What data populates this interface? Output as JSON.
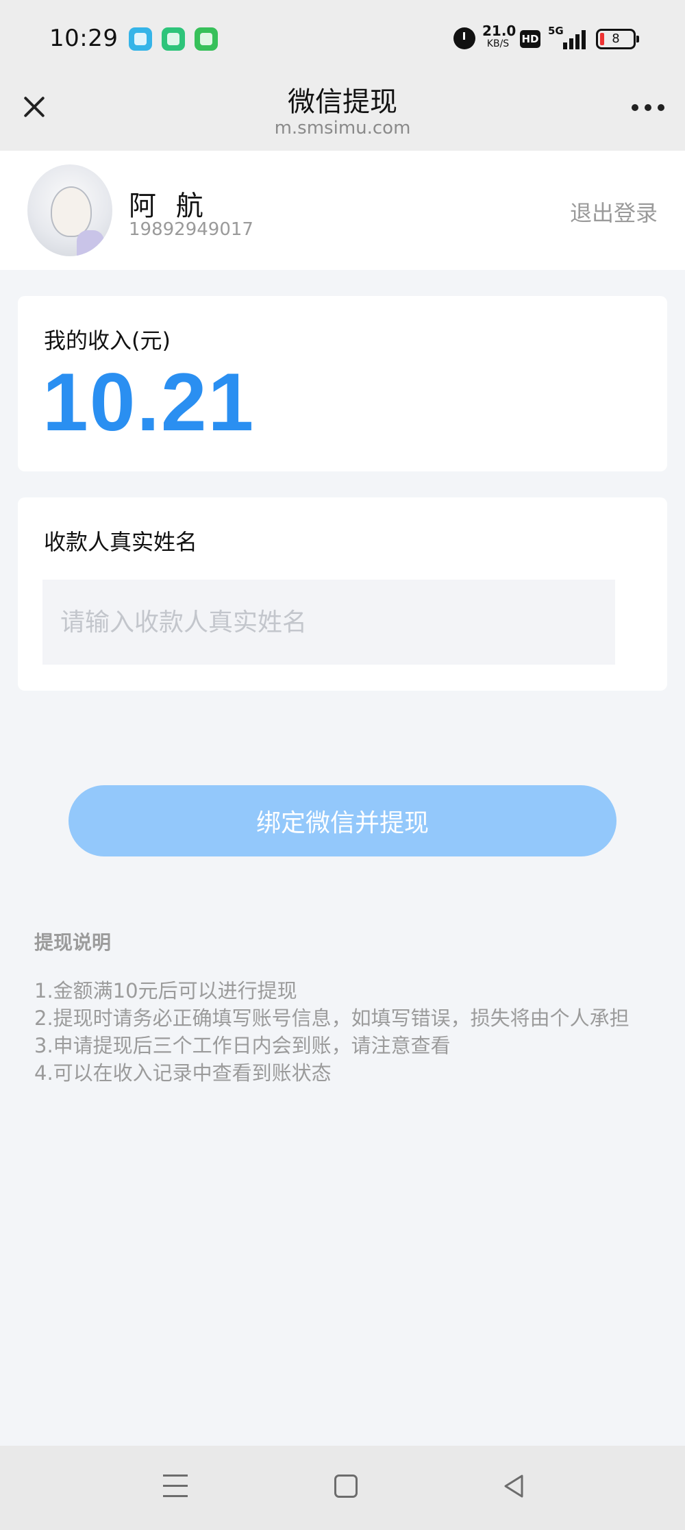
{
  "status_bar": {
    "time": "10:29",
    "net_speed_value": "21.0",
    "net_speed_unit": "KB/S",
    "hd_label": "HD",
    "network_label": "5G",
    "battery_level": "8"
  },
  "nav": {
    "title": "微信提现",
    "url": "m.smsimu.com"
  },
  "profile": {
    "name": "阿 航",
    "phone": "19892949017",
    "logout_label": "退出登录"
  },
  "income": {
    "label": "我的收入(元)",
    "amount": "10.21"
  },
  "payee": {
    "label": "收款人真实姓名",
    "placeholder": "请输入收款人真实姓名",
    "value": ""
  },
  "submit_label": "绑定微信并提现",
  "notes": {
    "title": "提现说明",
    "items": [
      "1.金额满10元后可以进行提现",
      "2.提现时请务必正确填写账号信息，如填写错误，损失将由个人承担",
      "3.申请提现后三个工作日内会到账，请注意查看",
      "4.可以在收入记录中查看到账状态"
    ]
  },
  "colors": {
    "accent": "#2a8ff1",
    "button": "#93c8fb",
    "background": "#f3f5f8"
  },
  "icons": {
    "close": "close-icon",
    "more": "more-icon",
    "menu": "menu-icon",
    "home": "home-icon",
    "back": "back-icon"
  }
}
